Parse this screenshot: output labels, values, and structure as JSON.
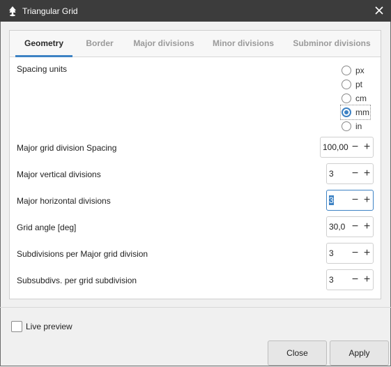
{
  "window": {
    "title": "Triangular Grid"
  },
  "tabs": [
    {
      "label": "Geometry",
      "active": true
    },
    {
      "label": "Border"
    },
    {
      "label": "Major divisions"
    },
    {
      "label": "Minor divisions"
    },
    {
      "label": "Subminor divisions"
    }
  ],
  "spacing_units": {
    "label": "Spacing units",
    "options": [
      "px",
      "pt",
      "cm",
      "mm",
      "in"
    ],
    "selected": "mm"
  },
  "fields": [
    {
      "label": "Major grid division Spacing",
      "value": "100,00"
    },
    {
      "label": "Major vertical divisions",
      "value": "3"
    },
    {
      "label": "Major horizontal divisions",
      "value": "3"
    },
    {
      "label": "Grid angle [deg]",
      "value": "30,0"
    },
    {
      "label": "Subdivisions per Major grid division",
      "value": "3"
    },
    {
      "label": "Subsubdivs. per grid subdivision",
      "value": "3"
    }
  ],
  "spin_glyphs": {
    "minus": "−",
    "plus": "+"
  },
  "live_preview": {
    "label": "Live preview",
    "checked": false
  },
  "buttons": {
    "close": "Close",
    "apply": "Apply"
  },
  "colors": {
    "accent": "#3d82c4",
    "titlebar": "#3c3c3c"
  },
  "icons": {
    "app": "inkscape-logo-icon",
    "close": "close-icon"
  }
}
